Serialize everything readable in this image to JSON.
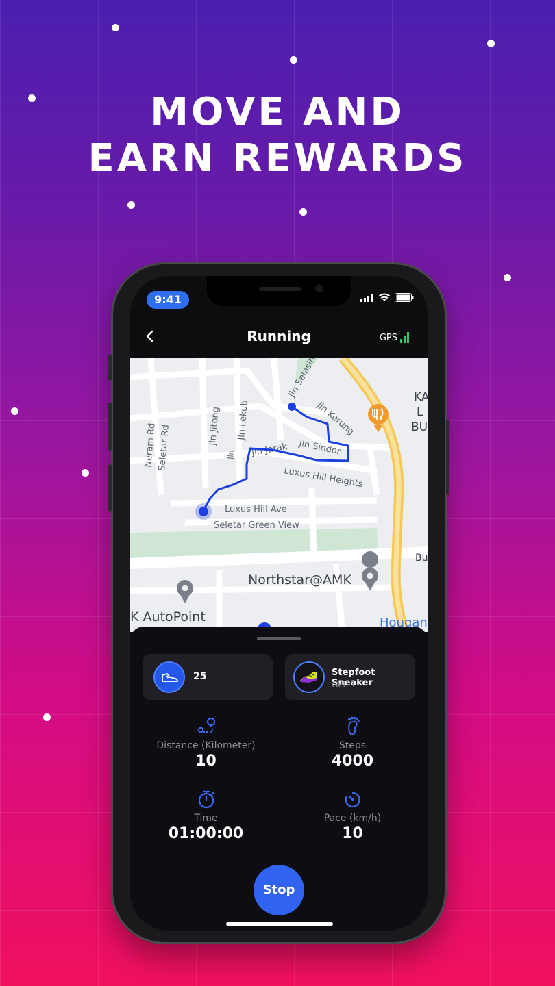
{
  "hero": {
    "line1": "MOVE AND",
    "line2": "EARN REWARDS"
  },
  "status_bar": {
    "time": "9:41"
  },
  "header": {
    "title": "Running",
    "gps_label": "GPS",
    "back_icon": "chevron-left-icon"
  },
  "map": {
    "streets": [
      "Jln Selasih",
      "Jln Kerung",
      "Jln Sindor",
      "Jln Jitong",
      "Jln Lekub",
      "Jln Jarak",
      "Neram Rd",
      "Seletar Rd",
      "Luxus Hill Heights",
      "Luxus Hill Ave",
      "Seletar Green View"
    ],
    "places": [
      "Northstar@AMK",
      "K AutoPoint",
      "Hougan"
    ],
    "edge_labels": [
      "KA",
      "L",
      "BU",
      "Bu",
      "Jln"
    ],
    "route_color": "#1c3fe0"
  },
  "summary": {
    "tokens": "25",
    "sneaker_name": "Stepfoot Sneaker",
    "sneaker_gel": "Gel: 1"
  },
  "stats": {
    "distance_label": "Distance (Kilometer)",
    "distance_value": "10",
    "steps_label": "Steps",
    "steps_value": "4000",
    "time_label": "Time",
    "time_value": "01:00:00",
    "pace_label": "Pace (km/h)",
    "pace_value": "10"
  },
  "actions": {
    "stop_label": "Stop"
  },
  "colors": {
    "accent": "#2f63f0",
    "panel": "#0e0e12",
    "card": "#1f1f25"
  }
}
